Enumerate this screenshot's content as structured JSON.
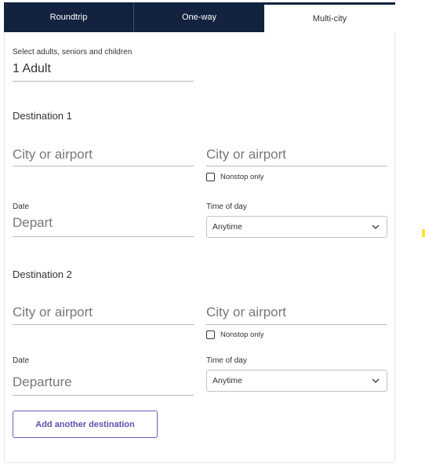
{
  "tabs": [
    {
      "label": "Roundtrip",
      "active": false
    },
    {
      "label": "One-way",
      "active": false
    },
    {
      "label": "Multi-city",
      "active": true
    }
  ],
  "passengers": {
    "label": "Select adults, seniors and children",
    "value": "1 Adult"
  },
  "destinations": [
    {
      "title": "Destination 1",
      "from_placeholder": "City or airport",
      "to_placeholder": "City or airport",
      "nonstop_label": "Nonstop only",
      "nonstop_checked": false,
      "date_label": "Date",
      "date_placeholder": "Depart",
      "time_label": "Time of day",
      "time_value": "Anytime"
    },
    {
      "title": "Destination 2",
      "from_placeholder": "City or airport",
      "to_placeholder": "City or airport",
      "nonstop_label": "Nonstop only",
      "nonstop_checked": false,
      "date_label": "Date",
      "date_placeholder": "Departure",
      "time_label": "Time of day",
      "time_value": "Anytime"
    }
  ],
  "add_destination_label": "Add another destination",
  "colors": {
    "tab_bg": "#12223f",
    "button_accent": "#6b5fc0"
  }
}
